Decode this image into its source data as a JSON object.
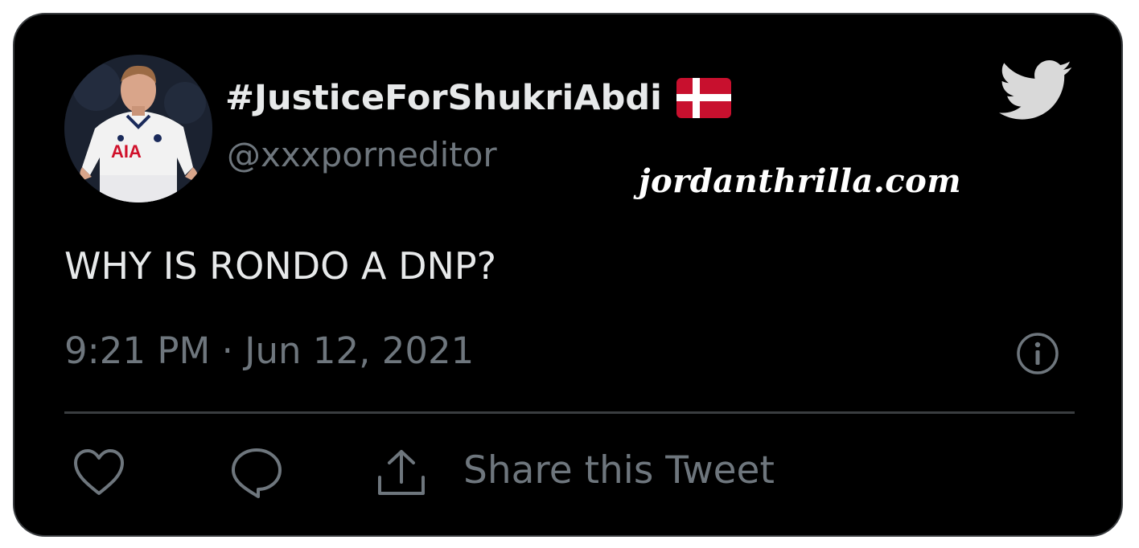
{
  "tweet": {
    "display_name": "#JusticeForShukriAbdi",
    "handle": "@xxxporneditor",
    "text": "WHY IS RONDO A DNP?",
    "timestamp": "9:21 PM · Jun 12, 2021",
    "share_label": "Share this Tweet",
    "flag": "denmark-flag",
    "watermark": "jordanthrilla.com"
  },
  "icons": {
    "brand": "twitter-bird-icon",
    "info": "info-icon",
    "like": "heart-icon",
    "reply": "comment-icon",
    "share": "share-icon"
  },
  "colors": {
    "background": "#000000",
    "primary_text": "#e7e9ea",
    "secondary_text": "#6e767d",
    "border": "#3a3d40",
    "flag_red": "#c8102e"
  }
}
